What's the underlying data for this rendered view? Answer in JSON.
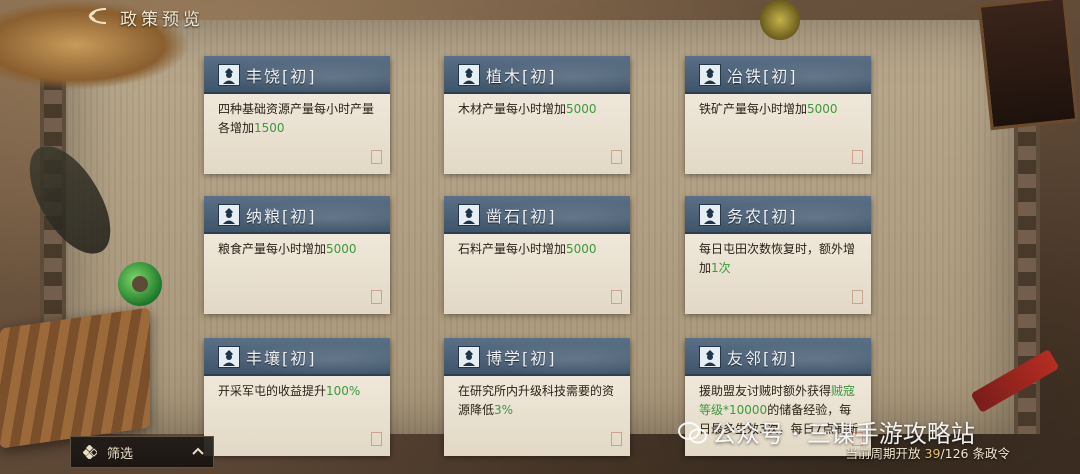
{
  "header": {
    "title": "政策预览"
  },
  "cards": [
    {
      "title": "丰饶[初]",
      "body": [
        {
          "t": "四种基础资源产量每小时产量各增加"
        },
        {
          "t": "1500",
          "hl": true
        }
      ]
    },
    {
      "title": "植木[初]",
      "body": [
        {
          "t": "木材产量每小时增加"
        },
        {
          "t": "5000",
          "hl": true
        }
      ]
    },
    {
      "title": "冶铁[初]",
      "body": [
        {
          "t": "铁矿产量每小时增加"
        },
        {
          "t": "5000",
          "hl": true
        }
      ]
    },
    {
      "title": "纳粮[初]",
      "body": [
        {
          "t": "粮食产量每小时增加"
        },
        {
          "t": "5000",
          "hl": true
        }
      ]
    },
    {
      "title": "凿石[初]",
      "body": [
        {
          "t": "石料产量每小时增加"
        },
        {
          "t": "5000",
          "hl": true
        }
      ]
    },
    {
      "title": "务农[初]",
      "body": [
        {
          "t": "每日屯田次数恢复时，额外增加"
        },
        {
          "t": "1次",
          "hl": true
        }
      ]
    },
    {
      "title": "丰壤[初]",
      "body": [
        {
          "t": "开采军屯的收益提升"
        },
        {
          "t": "100%",
          "hl": true
        }
      ]
    },
    {
      "title": "博学[初]",
      "body": [
        {
          "t": "在研究所内升级科技需要的资源降低"
        },
        {
          "t": "3%",
          "hl": true
        }
      ]
    },
    {
      "title": "友邻[初]",
      "body": [
        {
          "t": "援助盟友讨贼时额外获得"
        },
        {
          "t": "贼寇等级*10000",
          "hl": true
        },
        {
          "t": "的储备经验，每日最多生效3次，每日7点刷新"
        }
      ]
    }
  ],
  "filter": {
    "label": "筛选"
  },
  "footer": {
    "prefix": "当前周期开放",
    "current": "39",
    "total": "/126",
    "suffix": "条政令"
  },
  "watermark": {
    "text": "公众号 · 三谋手游攻略站"
  },
  "colors": {
    "highlight": "#3c9a3b",
    "card_header": "#4a6078"
  }
}
